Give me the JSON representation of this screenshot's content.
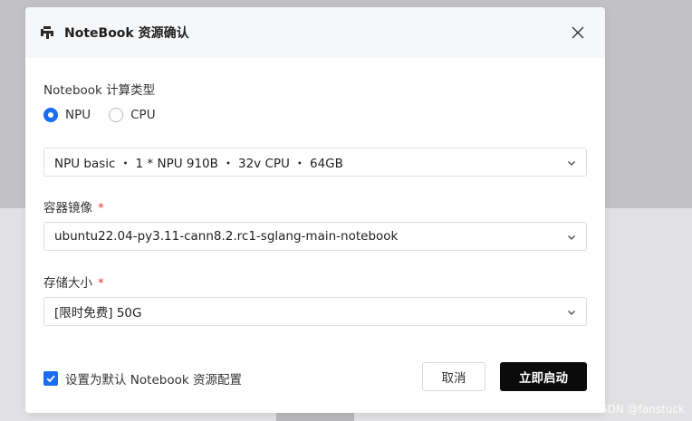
{
  "dialog": {
    "title": "NoteBook 资源确认",
    "logo_icon": "notebook-logo-icon",
    "close_icon": "close-icon"
  },
  "compute": {
    "label": "Notebook 计算类型",
    "options": [
      {
        "label": "NPU",
        "checked": true
      },
      {
        "label": "CPU",
        "checked": false
      }
    ],
    "spec_value": "NPU basic ・ 1 * NPU 910B ・ 32v CPU ・ 64GB"
  },
  "image": {
    "label": "容器镜像",
    "required_mark": "*",
    "value": "ubuntu22.04-py3.11-cann8.2.rc1-sglang-main-notebook"
  },
  "storage": {
    "label": "存储大小",
    "required_mark": "*",
    "value": "[限时免费] 50G"
  },
  "footer": {
    "default_checkbox_label": "设置为默认 Notebook 资源配置",
    "default_checked": true,
    "cancel_label": "取消",
    "confirm_label": "立即启动"
  },
  "watermark": "CSDN @fanstuck",
  "colors": {
    "accent": "#1a6cf0",
    "primary_button": "#0b0b0b",
    "required": "#e53935"
  }
}
